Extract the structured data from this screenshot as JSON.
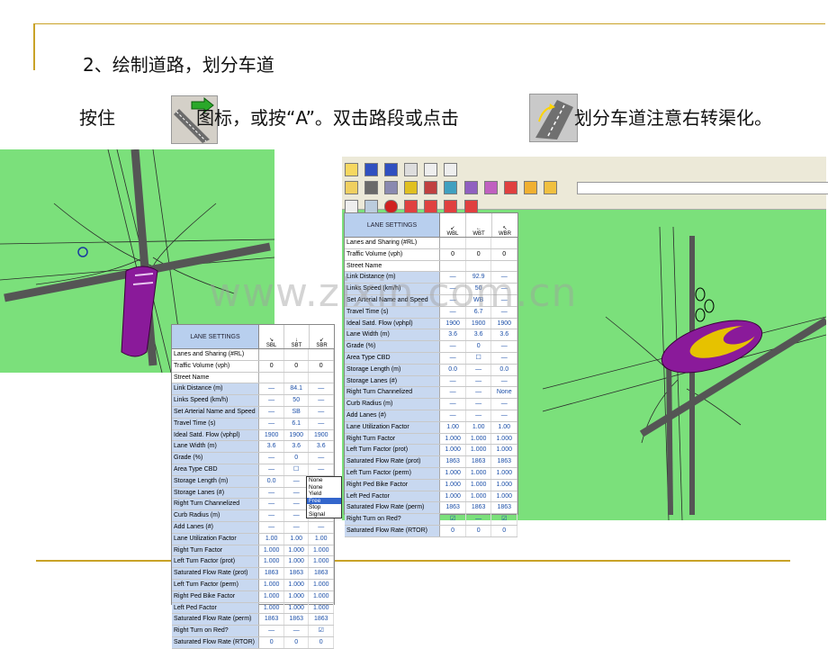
{
  "slide": {
    "step_title": "2、绘制道路，划分车道",
    "instruction_part1": "按住",
    "instruction_part2": "图标，或按“A”。双击路段或点击",
    "instruction_part3": "划分车道注意右转渠化。",
    "watermark": "www.zixin.com.cn"
  },
  "left_panel": {
    "title": "LANE SETTINGS",
    "columns": [
      "SBL",
      "SBT",
      "SBR"
    ],
    "rows": [
      {
        "label": "Lanes and Sharing (#RL)",
        "values": [
          "",
          "",
          ""
        ]
      },
      {
        "label": "Traffic Volume (vph)",
        "values": [
          "0",
          "0",
          "0"
        ]
      },
      {
        "label": "Street Name",
        "values": [
          "",
          "",
          ""
        ]
      },
      {
        "label": "Link Distance (m)",
        "values": [
          "—",
          "84.1",
          "—"
        ]
      },
      {
        "label": "Links Speed (km/h)",
        "values": [
          "—",
          "50",
          "—"
        ]
      },
      {
        "label": "Set Arterial Name and Speed",
        "values": [
          "—",
          "SB",
          "—"
        ]
      },
      {
        "label": "Travel Time (s)",
        "values": [
          "—",
          "6.1",
          "—"
        ]
      },
      {
        "label": "Ideal Satd. Flow (vphpl)",
        "values": [
          "1900",
          "1900",
          "1900"
        ]
      },
      {
        "label": "Lane Width (m)",
        "values": [
          "3.6",
          "3.6",
          "3.6"
        ]
      },
      {
        "label": "Grade (%)",
        "values": [
          "—",
          "0",
          "—"
        ]
      },
      {
        "label": "Area Type CBD",
        "values": [
          "—",
          "☐",
          "—"
        ]
      },
      {
        "label": "Storage Length (m)",
        "values": [
          "0.0",
          "—",
          "0.0"
        ]
      },
      {
        "label": "Storage Lanes (#)",
        "values": [
          "—",
          "—",
          "—"
        ]
      },
      {
        "label": "Right Turn Channelized",
        "values": [
          "—",
          "—",
          "None"
        ]
      },
      {
        "label": "Curb Radius (m)",
        "values": [
          "—",
          "—",
          "—"
        ]
      },
      {
        "label": "Add Lanes (#)",
        "values": [
          "—",
          "—",
          "—"
        ]
      },
      {
        "label": "Lane Utilization Factor",
        "values": [
          "1.00",
          "1.00",
          "1.00"
        ]
      },
      {
        "label": "Right Turn Factor",
        "values": [
          "1.000",
          "1.000",
          "1.000"
        ]
      },
      {
        "label": "Left Turn Factor (prot)",
        "values": [
          "1.000",
          "1.000",
          "1.000"
        ]
      },
      {
        "label": "Saturated Flow Rate (prot)",
        "values": [
          "1863",
          "1863",
          "1863"
        ]
      },
      {
        "label": "Left Turn Factor (perm)",
        "values": [
          "1.000",
          "1.000",
          "1.000"
        ]
      },
      {
        "label": "Right Ped Bike Factor",
        "values": [
          "1.000",
          "1.000",
          "1.000"
        ]
      },
      {
        "label": "Left Ped Factor",
        "values": [
          "1.000",
          "1.000",
          "1.000"
        ]
      },
      {
        "label": "Saturated Flow Rate (perm)",
        "values": [
          "1863",
          "1863",
          "1863"
        ]
      },
      {
        "label": "Right Turn on Red?",
        "values": [
          "—",
          "—",
          "☑"
        ]
      },
      {
        "label": "Saturated Flow Rate (RTOR)",
        "values": [
          "0",
          "0",
          "0"
        ]
      }
    ],
    "dropdown_options": [
      "None",
      "None",
      "Yield",
      "Free",
      "Stop",
      "Signal"
    ],
    "dropdown_selected": "Free"
  },
  "right_panel": {
    "title": "LANE SETTINGS",
    "columns": [
      "WBL",
      "WBT",
      "WBR"
    ],
    "rows": [
      {
        "label": "Lanes and Sharing (#RL)",
        "values": [
          "",
          "",
          ""
        ]
      },
      {
        "label": "Traffic Volume (vph)",
        "values": [
          "0",
          "0",
          "0"
        ]
      },
      {
        "label": "Street Name",
        "values": [
          "",
          "",
          ""
        ]
      },
      {
        "label": "Link Distance (m)",
        "values": [
          "—",
          "92.9",
          "—"
        ]
      },
      {
        "label": "Links Speed (km/h)",
        "values": [
          "—",
          "50",
          "—"
        ]
      },
      {
        "label": "Set Arterial Name and Speed",
        "values": [
          "—",
          "WB",
          "—"
        ]
      },
      {
        "label": "Travel Time (s)",
        "values": [
          "—",
          "6.7",
          "—"
        ]
      },
      {
        "label": "Ideal Satd. Flow (vphpl)",
        "values": [
          "1900",
          "1900",
          "1900"
        ]
      },
      {
        "label": "Lane Width (m)",
        "values": [
          "3.6",
          "3.6",
          "3.6"
        ]
      },
      {
        "label": "Grade (%)",
        "values": [
          "—",
          "0",
          "—"
        ]
      },
      {
        "label": "Area Type CBD",
        "values": [
          "—",
          "☐",
          "—"
        ]
      },
      {
        "label": "Storage Length (m)",
        "values": [
          "0.0",
          "—",
          "0.0"
        ]
      },
      {
        "label": "Storage Lanes (#)",
        "values": [
          "—",
          "—",
          "—"
        ]
      },
      {
        "label": "Right Turn Channelized",
        "values": [
          "—",
          "—",
          "None"
        ]
      },
      {
        "label": "Curb Radius (m)",
        "values": [
          "—",
          "—",
          "—"
        ]
      },
      {
        "label": "Add Lanes (#)",
        "values": [
          "—",
          "—",
          "—"
        ]
      },
      {
        "label": "Lane Utilization Factor",
        "values": [
          "1.00",
          "1.00",
          "1.00"
        ]
      },
      {
        "label": "Right Turn Factor",
        "values": [
          "1.000",
          "1.000",
          "1.000"
        ]
      },
      {
        "label": "Left Turn Factor (prot)",
        "values": [
          "1.000",
          "1.000",
          "1.000"
        ]
      },
      {
        "label": "Saturated Flow Rate (prot)",
        "values": [
          "1863",
          "1863",
          "1863"
        ]
      },
      {
        "label": "Left Turn Factor (perm)",
        "values": [
          "1.000",
          "1.000",
          "1.000"
        ]
      },
      {
        "label": "Right Ped Bike Factor",
        "values": [
          "1.000",
          "1.000",
          "1.000"
        ]
      },
      {
        "label": "Left Ped Factor",
        "values": [
          "1.000",
          "1.000",
          "1.000"
        ]
      },
      {
        "label": "Saturated Flow Rate (perm)",
        "values": [
          "1863",
          "1863",
          "1863"
        ]
      },
      {
        "label": "Right Turn on Red?",
        "values": [
          "☑",
          "—",
          "☑"
        ]
      },
      {
        "label": "Saturated Flow Rate (RTOR)",
        "values": [
          "0",
          "0",
          "0"
        ]
      }
    ]
  },
  "colors": {
    "gold": "#c9a227",
    "map_green": "#7be07b",
    "road": "#555555",
    "channel_purple": "#8a1a9a",
    "channel_yellow": "#e6c200",
    "table_header_blue": "#b8cfee",
    "value_blue": "#1a4ea8"
  },
  "icons": {
    "draw_link": "road-arrow-icon",
    "lane_settings": "lane-settings-icon"
  }
}
